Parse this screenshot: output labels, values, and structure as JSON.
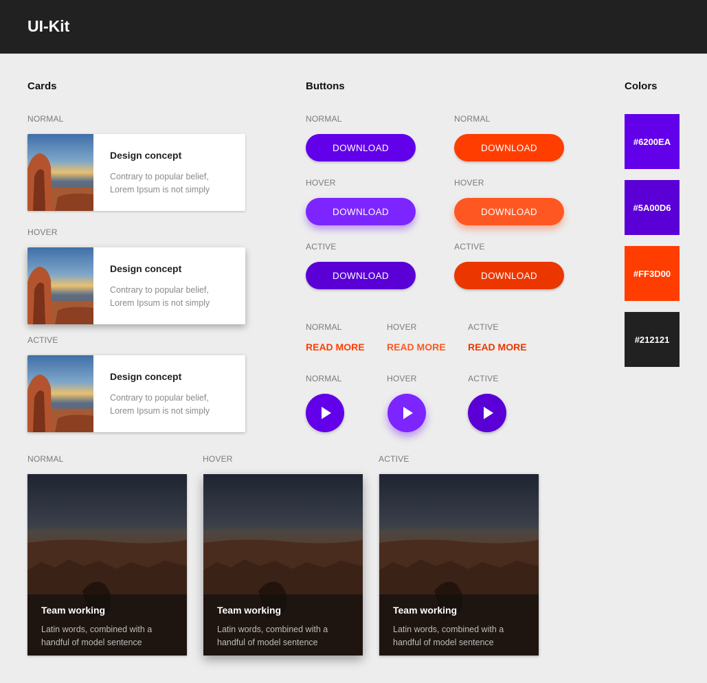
{
  "header": {
    "title": "UI-Kit"
  },
  "sections": {
    "cards": "Cards",
    "buttons": "Buttons",
    "colors": "Colors"
  },
  "states": {
    "normal": "NORMAL",
    "hover": "HOVER",
    "active": "ACTIVE"
  },
  "horizontal_card": {
    "title": "Design concept",
    "text_line1": "Contrary to popular belief,",
    "text_line2": "Lorem Ipsum is not simply"
  },
  "buttons": {
    "download_label": "DOWNLOAD",
    "read_more_label": "READ MORE"
  },
  "colors": [
    {
      "hex": "#6200EA",
      "label": "#6200EA"
    },
    {
      "hex": "#5A00D6",
      "label": "#5A00D6"
    },
    {
      "hex": "#FF3D00",
      "label": "#FF3D00"
    },
    {
      "hex": "#212121",
      "label": "#212121"
    }
  ],
  "vertical_card": {
    "title": "Team working",
    "text_line1": "Latin words, combined with a",
    "text_line2": "handful of model sentence"
  }
}
